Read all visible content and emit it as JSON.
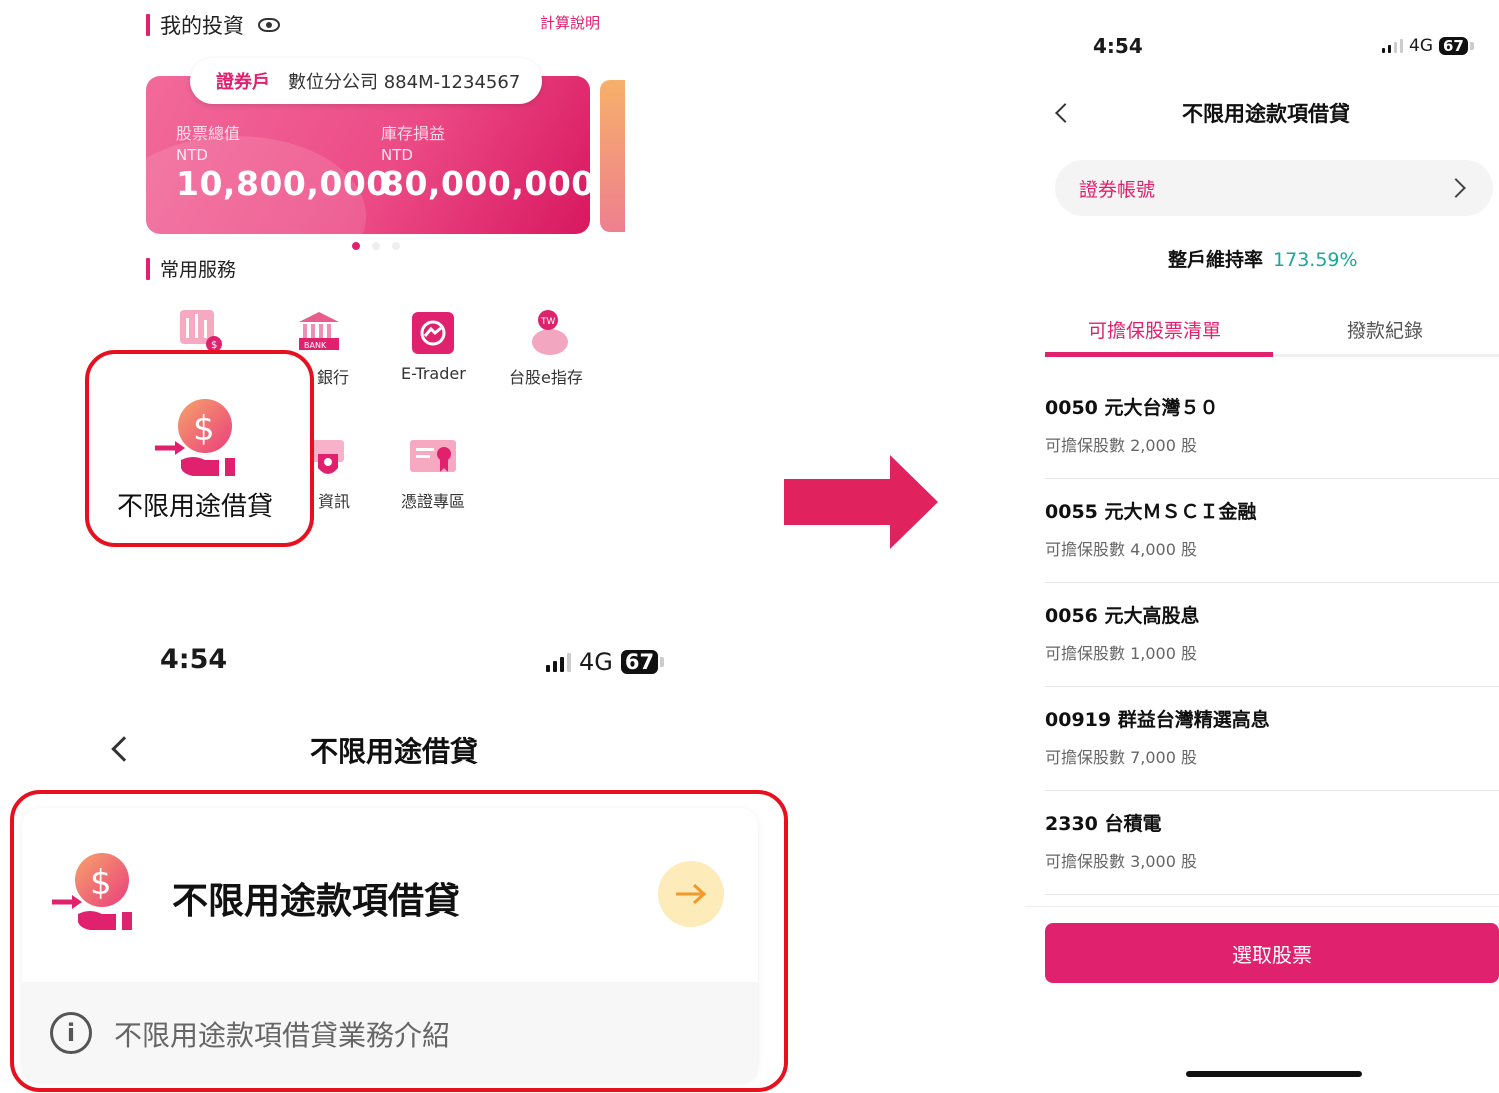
{
  "investment": {
    "title": "我的投資",
    "calc_link": "計算說明",
    "account_label": "證券戶",
    "account_value": "數位分公司 884M-1234567",
    "stock_value_label": "股票總值",
    "stock_value_currency": "NTD",
    "stock_value": "10,800,000",
    "pnl_label": "庫存損益",
    "pnl_currency": "NTD",
    "pnl_value": "80,000,000"
  },
  "services": {
    "title": "常用服務",
    "items": [
      {
        "label": "銀行"
      },
      {
        "label": "E-Trader"
      },
      {
        "label": "台股e指存"
      },
      {
        "label": "資訊"
      },
      {
        "label": "憑證專區"
      }
    ],
    "highlight_label": "不限用途借貸"
  },
  "phone_left": {
    "time": "4:54",
    "network": "4G",
    "battery": "67",
    "title": "不限用途借貸",
    "card_title": "不限用途款項借貸",
    "info_text": "不限用途款項借貸業務介紹"
  },
  "phone_right": {
    "time": "4:54",
    "network": "4G",
    "battery": "67",
    "title": "不限用途款項借貸",
    "account_label": "證券帳號",
    "maint_label": "整戶維持率",
    "maint_value": "173.59%",
    "tabs": [
      "可擔保股票清單",
      "撥款紀錄"
    ],
    "stocks": [
      {
        "name": "0050 元大台灣５０",
        "qty": "可擔保股數 2,000 股"
      },
      {
        "name": "0055 元大ＭＳＣＩ金融",
        "qty": "可擔保股數 4,000 股"
      },
      {
        "name": "0056 元大高股息",
        "qty": "可擔保股數 1,000 股"
      },
      {
        "name": "00919 群益台灣精選高息",
        "qty": "可擔保股數 7,000 股"
      },
      {
        "name": "2330 台積電",
        "qty": "可擔保股數 3,000 股"
      }
    ],
    "select_button": "選取股票"
  },
  "colors": {
    "brand": "#e0226e",
    "highlight": "#e8101e",
    "maint_green": "#1aa89a",
    "arrow_pink": "#e0225f"
  },
  "icons": [
    "eye-icon",
    "stock-chart-icon",
    "bank-icon",
    "etrader-icon",
    "piggy-bank-icon",
    "security-icon",
    "certificate-icon",
    "loan-hand-icon",
    "back-chevron-icon",
    "arrow-right-icon",
    "info-icon",
    "forward-chevron-icon"
  ]
}
